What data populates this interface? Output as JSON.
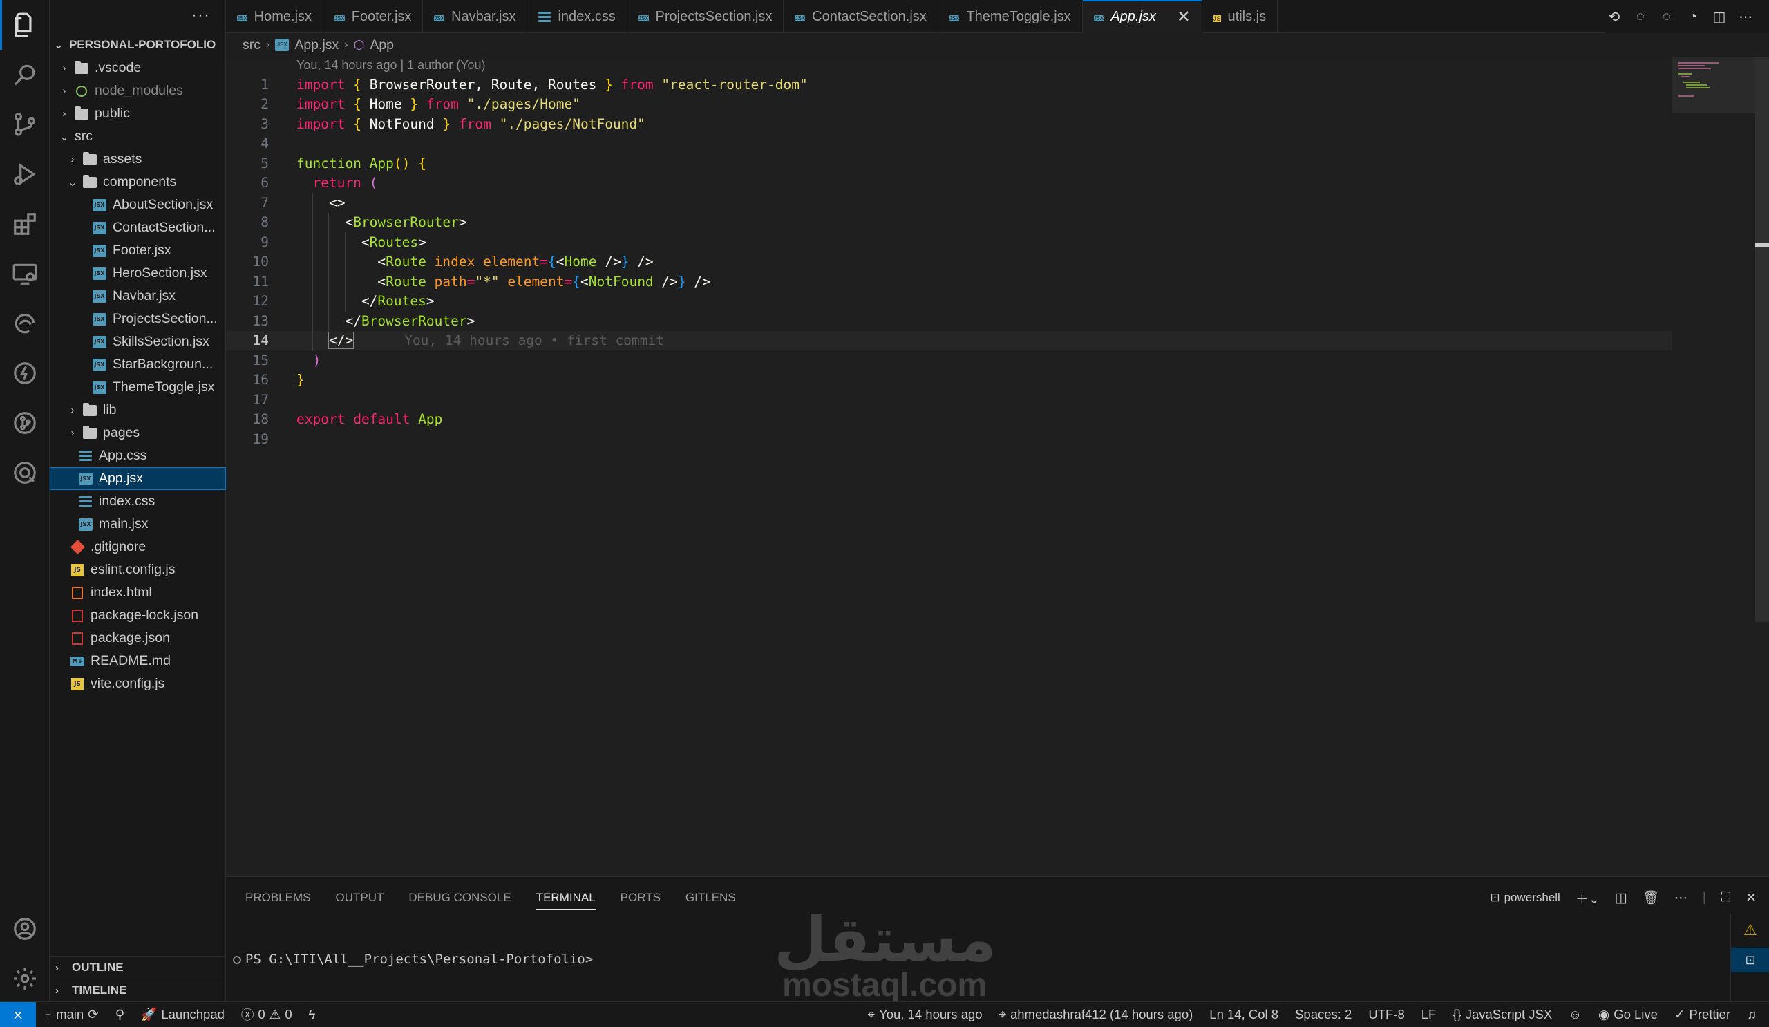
{
  "sidebar": {
    "more": "···",
    "project": "PERSONAL-PORTOFOLIO",
    "tree": [
      {
        "label": ".vscode",
        "kind": "folder",
        "depth": 1,
        "open": false
      },
      {
        "label": "node_modules",
        "kind": "node",
        "depth": 1,
        "open": false,
        "dim": true
      },
      {
        "label": "public",
        "kind": "folder",
        "depth": 1,
        "open": false
      },
      {
        "label": "src",
        "kind": "none",
        "depth": 1,
        "open": true
      },
      {
        "label": "assets",
        "kind": "folder",
        "depth": 2,
        "open": false
      },
      {
        "label": "components",
        "kind": "folder",
        "depth": 2,
        "open": true
      },
      {
        "label": "AboutSection.jsx",
        "kind": "jsx",
        "depth": 3
      },
      {
        "label": "ContactSection...",
        "kind": "jsx",
        "depth": 3
      },
      {
        "label": "Footer.jsx",
        "kind": "jsx",
        "depth": 3
      },
      {
        "label": "HeroSection.jsx",
        "kind": "jsx",
        "depth": 3
      },
      {
        "label": "Navbar.jsx",
        "kind": "jsx",
        "depth": 3
      },
      {
        "label": "ProjectsSection...",
        "kind": "jsx",
        "depth": 3
      },
      {
        "label": "SkillsSection.jsx",
        "kind": "jsx",
        "depth": 3
      },
      {
        "label": "StarBackgroun...",
        "kind": "jsx",
        "depth": 3
      },
      {
        "label": "ThemeToggle.jsx",
        "kind": "jsx",
        "depth": 3
      },
      {
        "label": "lib",
        "kind": "folder",
        "depth": 2,
        "open": false
      },
      {
        "label": "pages",
        "kind": "folder",
        "depth": 2,
        "open": false
      },
      {
        "label": "App.css",
        "kind": "css",
        "depth": 2
      },
      {
        "label": "App.jsx",
        "kind": "jsx",
        "depth": 2,
        "selected": true
      },
      {
        "label": "index.css",
        "kind": "css",
        "depth": 2
      },
      {
        "label": "main.jsx",
        "kind": "jsx",
        "depth": 2
      },
      {
        "label": ".gitignore",
        "kind": "git",
        "depth": 1
      },
      {
        "label": "eslint.config.js",
        "kind": "js",
        "depth": 1
      },
      {
        "label": "index.html",
        "kind": "html",
        "depth": 1
      },
      {
        "label": "package-lock.json",
        "kind": "json",
        "depth": 1
      },
      {
        "label": "package.json",
        "kind": "json",
        "depth": 1
      },
      {
        "label": "README.md",
        "kind": "md",
        "depth": 1
      },
      {
        "label": "vite.config.js",
        "kind": "js",
        "depth": 1
      }
    ],
    "outline": "OUTLINE",
    "timeline": "TIMELINE"
  },
  "tabs": [
    {
      "label": "Home.jsx",
      "kind": "jsx"
    },
    {
      "label": "Footer.jsx",
      "kind": "jsx"
    },
    {
      "label": "Navbar.jsx",
      "kind": "jsx"
    },
    {
      "label": "index.css",
      "kind": "css"
    },
    {
      "label": "ProjectsSection.jsx",
      "kind": "jsx"
    },
    {
      "label": "ContactSection.jsx",
      "kind": "jsx"
    },
    {
      "label": "ThemeToggle.jsx",
      "kind": "jsx"
    },
    {
      "label": "App.jsx",
      "kind": "jsx",
      "active": true
    },
    {
      "label": "utils.js",
      "kind": "js"
    }
  ],
  "breadcrumb": {
    "folder": "src",
    "file": "App.jsx",
    "symbol": "App"
  },
  "editor": {
    "codelens": "You, 14 hours ago | 1 author (You)",
    "current_line": 14,
    "blame": "You, 14 hours ago • first commit",
    "lines": [
      [
        [
          "kw",
          "import"
        ],
        [
          "txt",
          " "
        ],
        [
          "brace",
          "{"
        ],
        [
          "txt",
          " BrowserRouter, Route, Routes "
        ],
        [
          "brace",
          "}"
        ],
        [
          "txt",
          " "
        ],
        [
          "kw",
          "from"
        ],
        [
          "txt",
          " "
        ],
        [
          "str",
          "\"react-router-dom\""
        ]
      ],
      [
        [
          "kw",
          "import"
        ],
        [
          "txt",
          " "
        ],
        [
          "brace",
          "{"
        ],
        [
          "txt",
          " Home "
        ],
        [
          "brace",
          "}"
        ],
        [
          "txt",
          " "
        ],
        [
          "kw",
          "from"
        ],
        [
          "txt",
          " "
        ],
        [
          "str",
          "\"./pages/Home\""
        ]
      ],
      [
        [
          "kw",
          "import"
        ],
        [
          "txt",
          " "
        ],
        [
          "brace",
          "{"
        ],
        [
          "txt",
          " NotFound "
        ],
        [
          "brace",
          "}"
        ],
        [
          "txt",
          " "
        ],
        [
          "kw",
          "from"
        ],
        [
          "txt",
          " "
        ],
        [
          "str",
          "\"./pages/NotFound\""
        ]
      ],
      [],
      [
        [
          "fn",
          "function"
        ],
        [
          "txt",
          " "
        ],
        [
          "fn",
          "App"
        ],
        [
          "brace",
          "()"
        ],
        [
          "txt",
          " "
        ],
        [
          "brace",
          "{"
        ]
      ],
      [
        [
          "txt",
          "  "
        ],
        [
          "kw",
          "return"
        ],
        [
          "txt",
          " "
        ],
        [
          "brace2",
          "("
        ]
      ],
      [
        [
          "txt",
          "    "
        ],
        [
          "punc",
          "<>"
        ]
      ],
      [
        [
          "txt",
          "      "
        ],
        [
          "punc",
          "<"
        ],
        [
          "tag",
          "BrowserRouter"
        ],
        [
          "punc",
          ">"
        ]
      ],
      [
        [
          "txt",
          "        "
        ],
        [
          "punc",
          "<"
        ],
        [
          "tag",
          "Routes"
        ],
        [
          "punc",
          ">"
        ]
      ],
      [
        [
          "txt",
          "          "
        ],
        [
          "punc",
          "<"
        ],
        [
          "tag",
          "Route"
        ],
        [
          "txt",
          " "
        ],
        [
          "attr",
          "index"
        ],
        [
          "txt",
          " "
        ],
        [
          "attr",
          "element"
        ],
        [
          "kw",
          "="
        ],
        [
          "brace3",
          "{"
        ],
        [
          "punc",
          "<"
        ],
        [
          "tag",
          "Home"
        ],
        [
          "punc",
          " />"
        ],
        [
          "brace3",
          "}"
        ],
        [
          "punc",
          " />"
        ]
      ],
      [
        [
          "txt",
          "          "
        ],
        [
          "punc",
          "<"
        ],
        [
          "tag",
          "Route"
        ],
        [
          "txt",
          " "
        ],
        [
          "attr",
          "path"
        ],
        [
          "kw",
          "="
        ],
        [
          "str",
          "\"*\""
        ],
        [
          "txt",
          " "
        ],
        [
          "attr",
          "element"
        ],
        [
          "kw",
          "="
        ],
        [
          "brace3",
          "{"
        ],
        [
          "punc",
          "<"
        ],
        [
          "tag",
          "NotFound"
        ],
        [
          "punc",
          " />"
        ],
        [
          "brace3",
          "}"
        ],
        [
          "punc",
          " />"
        ]
      ],
      [
        [
          "txt",
          "        "
        ],
        [
          "punc",
          "</"
        ],
        [
          "tag",
          "Routes"
        ],
        [
          "punc",
          ">"
        ]
      ],
      [
        [
          "txt",
          "      "
        ],
        [
          "punc",
          "</"
        ],
        [
          "tag",
          "BrowserRouter"
        ],
        [
          "punc",
          ">"
        ]
      ],
      [
        [
          "txt",
          "    "
        ],
        [
          "punc",
          "</>"
        ]
      ],
      [
        [
          "txt",
          "  "
        ],
        [
          "brace2",
          ")"
        ]
      ],
      [
        [
          "brace",
          "}"
        ]
      ],
      [],
      [
        [
          "kw",
          "export"
        ],
        [
          "txt",
          " "
        ],
        [
          "kw",
          "default"
        ],
        [
          "txt",
          " "
        ],
        [
          "fn",
          "App"
        ]
      ],
      []
    ]
  },
  "panel": {
    "tabs": [
      "PROBLEMS",
      "OUTPUT",
      "DEBUG CONSOLE",
      "TERMINAL",
      "PORTS",
      "GITLENS"
    ],
    "active_tab": "TERMINAL",
    "shell": "powershell",
    "prompt": "PS G:\\ITI\\All__Projects\\Personal-Portofolio>"
  },
  "watermark": {
    "logo": "مستقل",
    "text": "mostaql.com"
  },
  "statusbar": {
    "branch": "main",
    "launchpad": "Launchpad",
    "errors": "0",
    "warnings": "0",
    "blame": "You, 14 hours ago",
    "author": "ahmedashraf412 (14 hours ago)",
    "position": "Ln 14, Col 8",
    "spaces": "Spaces: 2",
    "encoding": "UTF-8",
    "eol": "LF",
    "language": "JavaScript JSX",
    "golive": "Go Live",
    "prettier": "Prettier"
  },
  "colors": {
    "accent": "#0078d4",
    "selection": "#04395e"
  }
}
